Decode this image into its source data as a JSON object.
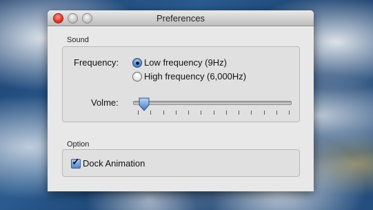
{
  "window": {
    "title": "Preferences"
  },
  "sound": {
    "section_label": "Sound",
    "frequency_label": "Frequency:",
    "options": [
      {
        "label": "Low frequency (9Hz)",
        "selected": true
      },
      {
        "label": "High frequency (6,000Hz)",
        "selected": false
      }
    ],
    "volume_label": "Volme:",
    "volume_level": 0.04,
    "tick_count": 13
  },
  "option": {
    "section_label": "Option",
    "dock_animation_label": "Dock Animation",
    "dock_animation_checked": true
  },
  "colors": {
    "accent": "#4f86cf",
    "close_button": "#e63a2a"
  }
}
